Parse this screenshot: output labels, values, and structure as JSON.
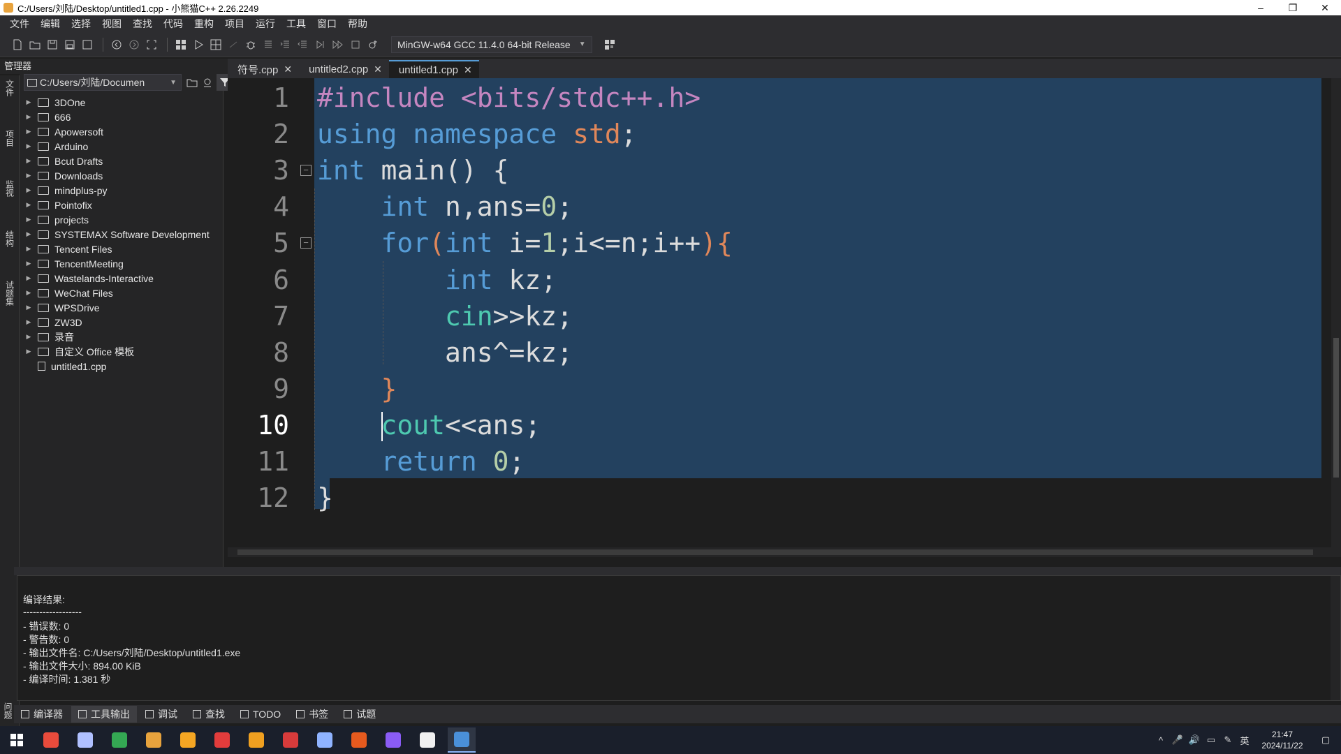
{
  "window": {
    "title": "C:/Users/刘陆/Desktop/untitled1.cpp - 小熊猫C++ 2.26.2249",
    "minimize": "–",
    "restore": "❐",
    "close": "✕"
  },
  "menu": [
    "文件",
    "编辑",
    "选择",
    "视图",
    "查找",
    "代码",
    "重构",
    "项目",
    "运行",
    "工具",
    "窗口",
    "帮助"
  ],
  "toolbar": {
    "compiler": "MinGW-w64 GCC 11.4.0 64-bit Release"
  },
  "manager": {
    "title": "管理器",
    "path": "C:/Users/刘陆/Documen",
    "tree": [
      {
        "label": "3DOne",
        "type": "folder"
      },
      {
        "label": "666",
        "type": "folder"
      },
      {
        "label": "Apowersoft",
        "type": "folder"
      },
      {
        "label": "Arduino",
        "type": "folder"
      },
      {
        "label": "Bcut Drafts",
        "type": "folder"
      },
      {
        "label": "Downloads",
        "type": "folder"
      },
      {
        "label": "mindplus-py",
        "type": "folder"
      },
      {
        "label": "Pointofix",
        "type": "folder"
      },
      {
        "label": "projects",
        "type": "folder"
      },
      {
        "label": "SYSTEMAX Software Development",
        "type": "folder"
      },
      {
        "label": "Tencent Files",
        "type": "folder"
      },
      {
        "label": "TencentMeeting",
        "type": "folder"
      },
      {
        "label": "Wastelands-Interactive",
        "type": "folder"
      },
      {
        "label": "WeChat Files",
        "type": "folder"
      },
      {
        "label": "WPSDrive",
        "type": "folder"
      },
      {
        "label": "ZW3D",
        "type": "folder"
      },
      {
        "label": "录音",
        "type": "folder"
      },
      {
        "label": "自定义 Office 模板",
        "type": "folder"
      },
      {
        "label": "untitled1.cpp",
        "type": "file"
      }
    ]
  },
  "left_tabs": [
    "文件",
    "项目",
    "监视",
    "结构",
    "试题集"
  ],
  "tabs": [
    {
      "label": "符号.cpp",
      "active": false
    },
    {
      "label": "untitled2.cpp",
      "active": false
    },
    {
      "label": "untitled1.cpp",
      "active": true
    }
  ],
  "editor": {
    "current_line": 10,
    "lines": [
      [
        {
          "t": "#include <bits/stdc++.h>",
          "c": "pp"
        }
      ],
      [
        {
          "t": "using ",
          "c": "k"
        },
        {
          "t": "namespace ",
          "c": "k"
        },
        {
          "t": "std",
          "c": "brace-or"
        },
        {
          "t": ";",
          "c": "plain"
        }
      ],
      [
        {
          "t": "int ",
          "c": "k"
        },
        {
          "t": "main() {",
          "c": "plain"
        }
      ],
      [
        {
          "t": "    ",
          "c": "plain"
        },
        {
          "t": "int ",
          "c": "k"
        },
        {
          "t": "n,ans=",
          "c": "plain"
        },
        {
          "t": "0",
          "c": "num"
        },
        {
          "t": ";",
          "c": "plain"
        }
      ],
      [
        {
          "t": "    ",
          "c": "plain"
        },
        {
          "t": "for",
          "c": "k"
        },
        {
          "t": "(",
          "c": "brace-or"
        },
        {
          "t": "int ",
          "c": "k"
        },
        {
          "t": "i=",
          "c": "plain"
        },
        {
          "t": "1",
          "c": "num"
        },
        {
          "t": ";i<=n;i++",
          "c": "plain"
        },
        {
          "t": "){",
          "c": "brace-or"
        }
      ],
      [
        {
          "t": "        ",
          "c": "plain"
        },
        {
          "t": "int ",
          "c": "k"
        },
        {
          "t": "kz;",
          "c": "plain"
        }
      ],
      [
        {
          "t": "        ",
          "c": "plain"
        },
        {
          "t": "cin",
          "c": "ty"
        },
        {
          "t": ">>kz;",
          "c": "plain"
        }
      ],
      [
        {
          "t": "        ",
          "c": "plain"
        },
        {
          "t": "ans^=kz;",
          "c": "plain"
        }
      ],
      [
        {
          "t": "    ",
          "c": "plain"
        },
        {
          "t": "}",
          "c": "brace-or"
        }
      ],
      [
        {
          "t": "    ",
          "c": "plain"
        },
        {
          "t": "CURSOR",
          "c": "cursor"
        },
        {
          "t": "cout",
          "c": "ty"
        },
        {
          "t": "<<ans;",
          "c": "plain"
        }
      ],
      [
        {
          "t": "    ",
          "c": "plain"
        },
        {
          "t": "return ",
          "c": "k"
        },
        {
          "t": "0",
          "c": "num"
        },
        {
          "t": ";",
          "c": "plain"
        }
      ],
      [
        {
          "t": "}",
          "c": "plain"
        }
      ]
    ]
  },
  "output": {
    "lines": [
      "编译结果:",
      "------------------",
      "- 错误数: 0",
      "- 警告数: 0",
      "- 输出文件名: C:/Users/刘陆/Desktop/untitled1.exe",
      "- 输出文件大小: 894.00 KiB",
      "- 编译时间: 1.381 秒"
    ]
  },
  "bottom_tabs": [
    {
      "label": "编译器",
      "active": false
    },
    {
      "label": "工具输出",
      "active": true
    },
    {
      "label": "调试",
      "active": false
    },
    {
      "label": "查找",
      "active": false
    },
    {
      "label": "TODO",
      "active": false
    },
    {
      "label": "书签",
      "active": false
    },
    {
      "label": "试题",
      "active": false
    }
  ],
  "bottom_left_label": "问题",
  "taskbar": {
    "apps": [
      "#e84b3c",
      "#b0c0ff",
      "#34a853",
      "#e8a33d",
      "#f5a623",
      "#e23c3c",
      "#f0a020",
      "#d83b3b",
      "#8fb3ff",
      "#e65a1e",
      "#8a5cf6",
      "#f0f0f0",
      "#4a90d9"
    ],
    "active_index": 12,
    "ime": "英",
    "time": "21:47",
    "date": "2024/11/22"
  }
}
